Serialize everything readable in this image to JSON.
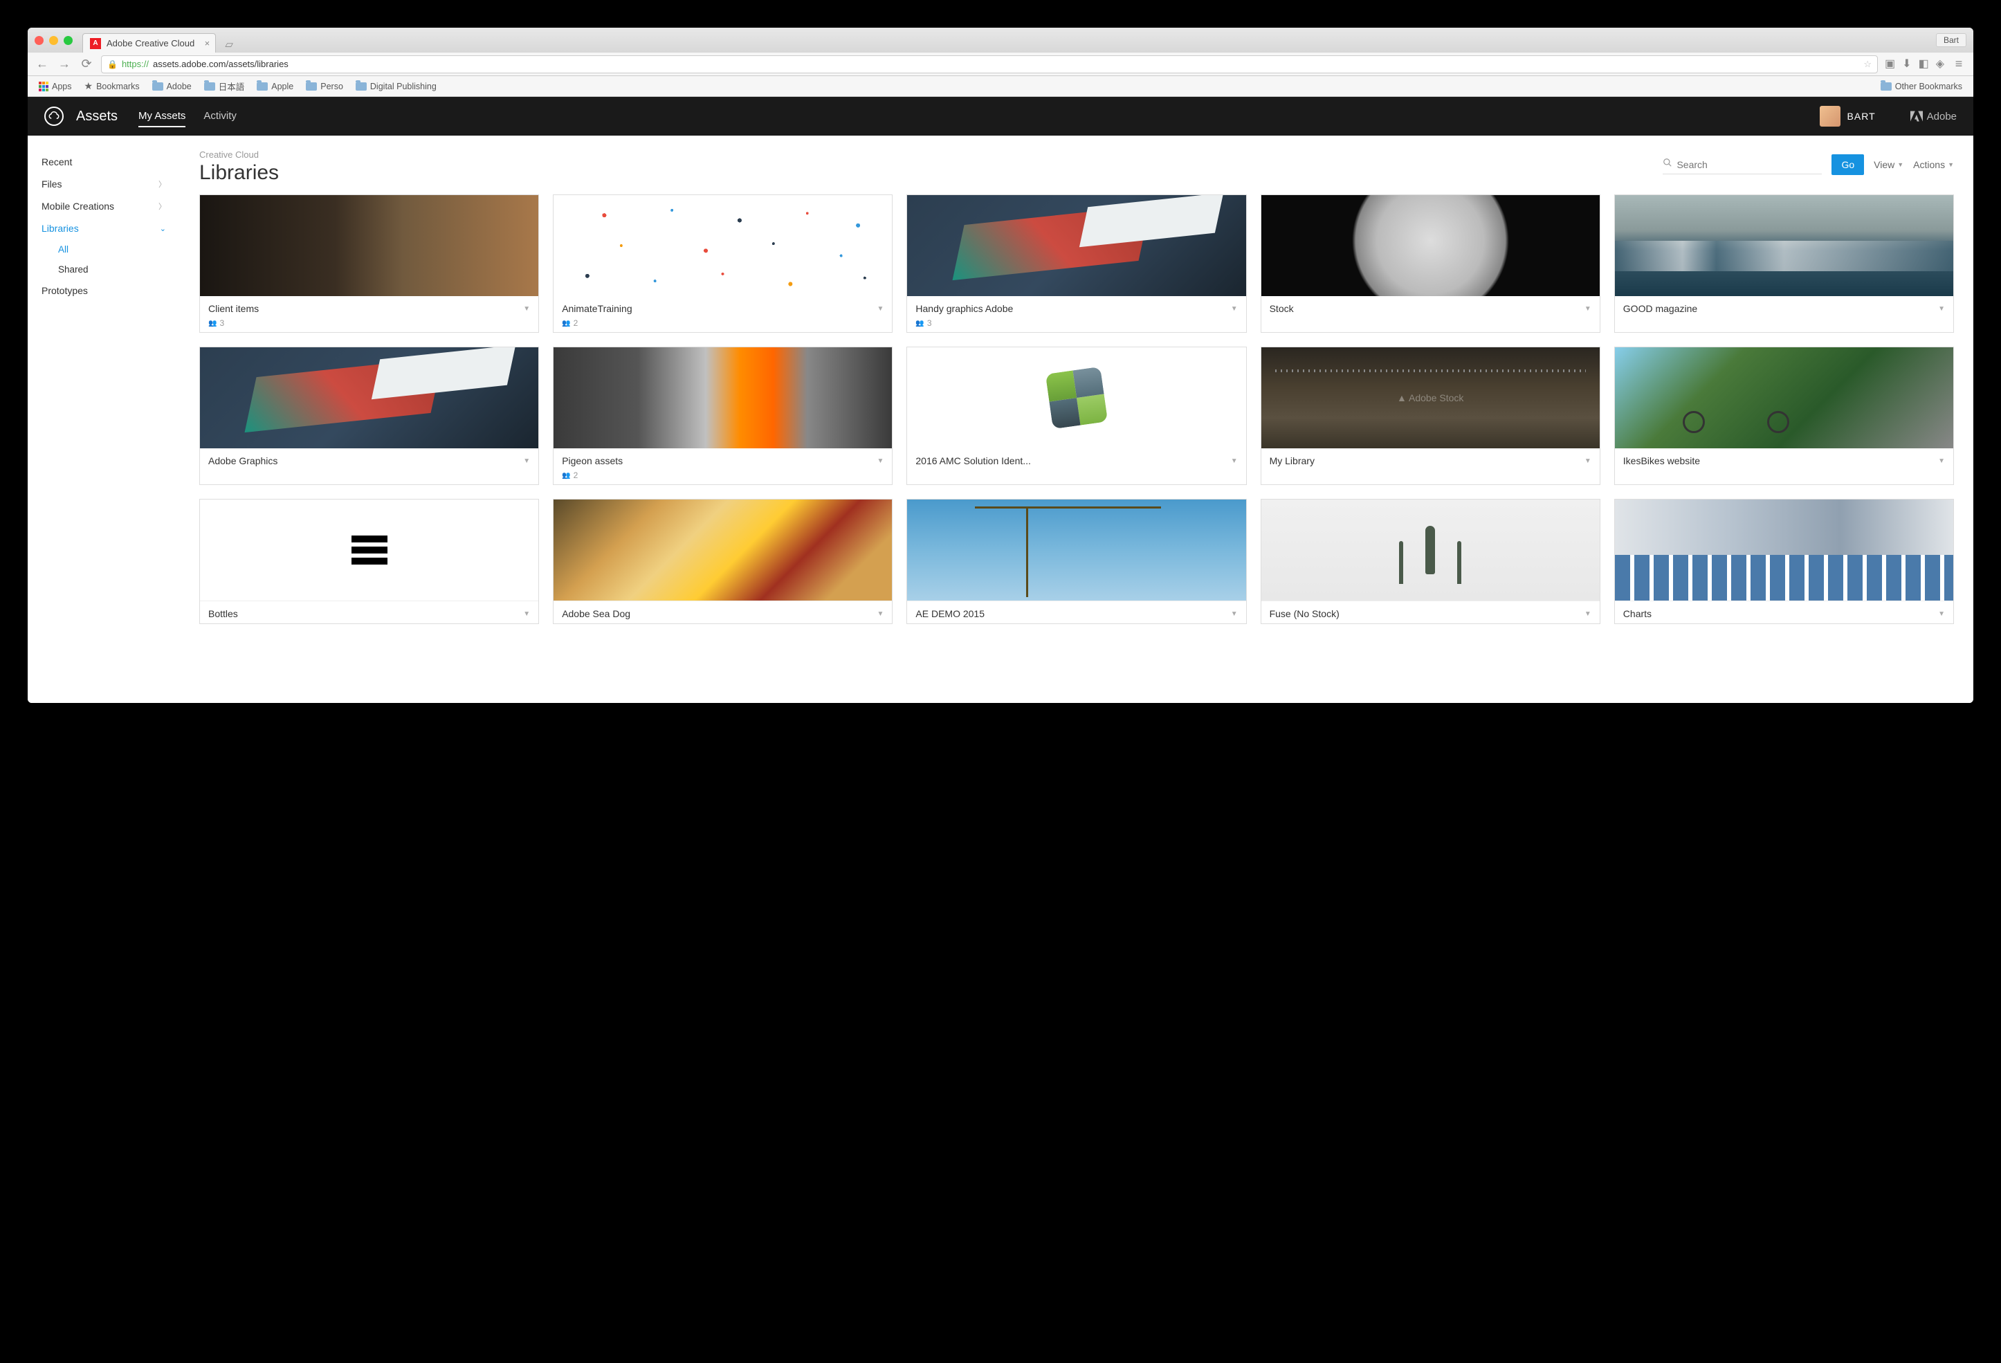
{
  "browser": {
    "tab_title": "Adobe Creative Cloud",
    "profile": "Bart",
    "url": "assets.adobe.com/assets/libraries",
    "https_prefix": "https://",
    "bookmarks": {
      "apps": "Apps",
      "bookmarks": "Bookmarks",
      "folders": [
        "Adobe",
        "日本語",
        "Apple",
        "Perso",
        "Digital Publishing"
      ],
      "other": "Other Bookmarks"
    }
  },
  "header": {
    "brand": "Assets",
    "nav": [
      "My Assets",
      "Activity"
    ],
    "active_nav": "My Assets",
    "user": "BART",
    "adobe": "Adobe"
  },
  "sidebar": {
    "items": [
      {
        "label": "Recent"
      },
      {
        "label": "Files",
        "expandable": true
      },
      {
        "label": "Mobile Creations",
        "expandable": true
      },
      {
        "label": "Libraries",
        "expandable": true,
        "active": true,
        "expanded": true,
        "children": [
          {
            "label": "All",
            "active": true
          },
          {
            "label": "Shared"
          }
        ]
      },
      {
        "label": "Prototypes"
      }
    ]
  },
  "content": {
    "breadcrumb": "Creative Cloud",
    "title": "Libraries",
    "search_placeholder": "Search",
    "go": "Go",
    "view": "View",
    "actions": "Actions"
  },
  "libraries": [
    {
      "title": "Client items",
      "count": "3",
      "thumb": "piano"
    },
    {
      "title": "AnimateTraining",
      "count": "2",
      "thumb": "dots"
    },
    {
      "title": "Handy graphics Adobe",
      "count": "3",
      "thumb": "mockup"
    },
    {
      "title": "Stock",
      "thumb": "moon"
    },
    {
      "title": "GOOD magazine",
      "thumb": "ocean"
    },
    {
      "title": "Adobe Graphics",
      "thumb": "mockup"
    },
    {
      "title": "Pigeon assets",
      "count": "2",
      "thumb": "pigeon"
    },
    {
      "title": "2016 AMC Solution Ident...",
      "thumb": "amc"
    },
    {
      "title": "My Library",
      "thumb": "radio"
    },
    {
      "title": "IkesBikes website",
      "thumb": "bikes"
    },
    {
      "title": "Bottles",
      "thumb": "bottles"
    },
    {
      "title": "Adobe Sea Dog",
      "thumb": "hotdog"
    },
    {
      "title": "AE DEMO 2015",
      "thumb": "crane"
    },
    {
      "title": "Fuse (No Stock)",
      "thumb": "fuse"
    },
    {
      "title": "Charts",
      "thumb": "charts"
    }
  ]
}
